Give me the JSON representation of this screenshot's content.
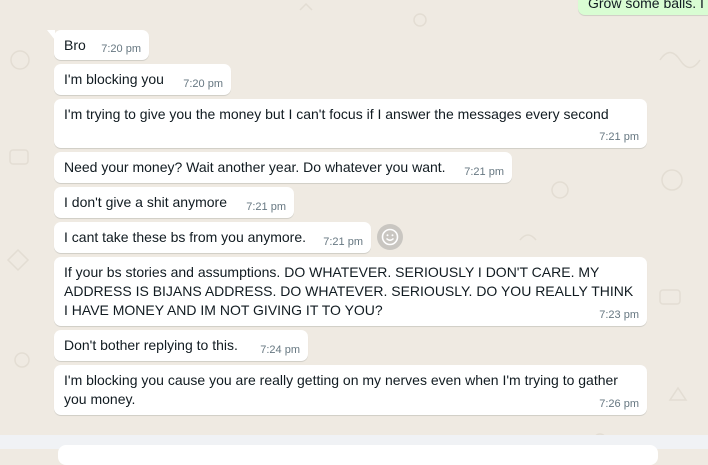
{
  "outgoing_partial": {
    "text": "Grow some balls. I"
  },
  "messages": [
    {
      "text": "Bro",
      "time": "7:20 pm"
    },
    {
      "text": "I'm blocking you",
      "time": "7:20 pm"
    },
    {
      "text": "I'm trying to give you the money but I can't focus if I answer the messages every second",
      "time": "7:21 pm"
    },
    {
      "text": "Need your money? Wait another year. Do whatever you want.",
      "time": "7:21 pm"
    },
    {
      "text": "I don't give a shit anymore",
      "time": "7:21 pm"
    },
    {
      "text": "I cant take these bs from you anymore.",
      "time": "7:21 pm"
    },
    {
      "text": "If your bs stories and assumptions. DO WHATEVER. SERIOUSLY I DON'T CARE. MY ADDRESS IS BIJANS ADDRESS. DO WHATEVER. SERIOUSLY. DO YOU REALLY THINK I HAVE MONEY AND IM NOT GIVING IT TO YOU?",
      "time": "7:23 pm"
    },
    {
      "text": "Don't bother replying to this.",
      "time": "7:24 pm"
    },
    {
      "text": "I'm blocking you cause you are really getting on my nerves even when I'm trying to gather you money.",
      "time": "7:26 pm"
    }
  ],
  "icons": {
    "react": "smiley-face-icon"
  },
  "colors": {
    "chat_background": "#efeae2",
    "incoming_bubble": "#ffffff",
    "outgoing_bubble": "#d9fdd3",
    "timestamp": "#667781"
  }
}
